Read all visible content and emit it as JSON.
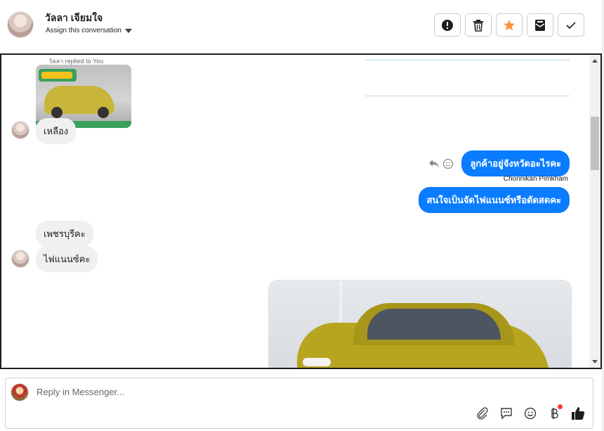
{
  "header": {
    "contact_name": "วัลลา เจียมใจ",
    "assign_label": "Assign this conversation",
    "actions": [
      {
        "name": "spam",
        "icon": "alert-icon"
      },
      {
        "name": "delete",
        "icon": "trash-icon"
      },
      {
        "name": "star",
        "icon": "star-icon",
        "color": "#f7923b"
      },
      {
        "name": "mark-unread",
        "icon": "envelope-icon"
      },
      {
        "name": "done",
        "icon": "check-icon"
      }
    ]
  },
  "conversation": {
    "replied_note": "วัลลา replied to You",
    "messages": [
      {
        "direction": "in",
        "text": "เหลือง"
      },
      {
        "direction": "out",
        "text": "ลูกค้าอยู่จังหวัดอะไรคะ",
        "sender": "Chonnikan Pimkham"
      },
      {
        "direction": "out",
        "text": "สนใจเป็นจัดไฟแนนซ์หรือตัดสดคะ"
      },
      {
        "direction": "in",
        "text": "เพชรบุรีคะ"
      },
      {
        "direction": "in",
        "text": "ไฟแนนซ์คะ"
      }
    ],
    "colors": {
      "outgoing": "#0a7cff",
      "incoming": "#f0f0f0"
    }
  },
  "composer": {
    "placeholder": "Reply in Messenger...",
    "icons": [
      "paperclip-icon",
      "saved-replies-icon",
      "emoji-icon",
      "baht-payment-icon",
      "thumbs-up-icon"
    ]
  }
}
